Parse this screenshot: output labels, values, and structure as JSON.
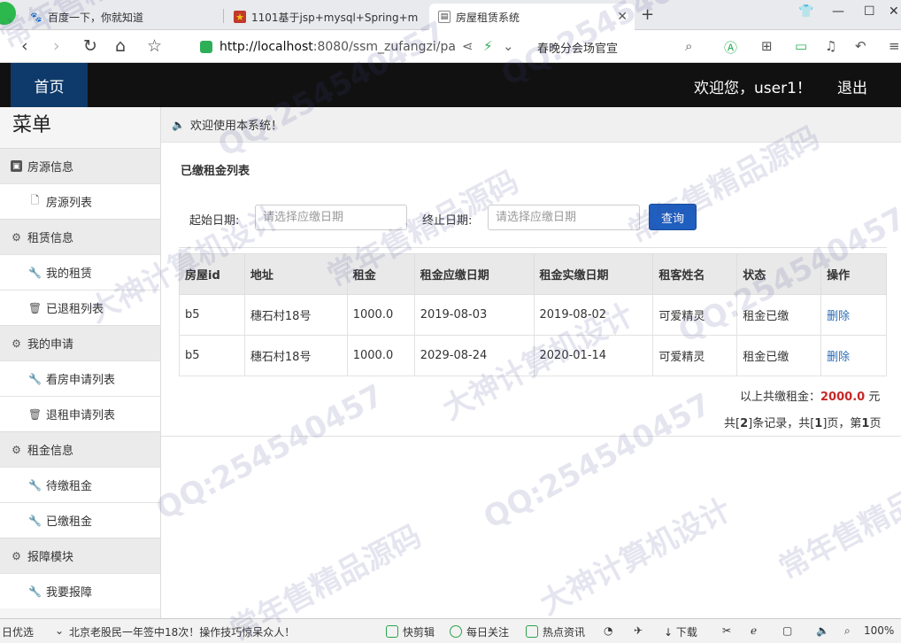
{
  "browser": {
    "tabs": [
      {
        "label": "百度一下，你就知道",
        "icon": "paw-icon"
      },
      {
        "label": "1101基于jsp+mysql+Spring+m",
        "icon": "site-icon"
      },
      {
        "label": "房屋租赁系统",
        "icon": "page-icon",
        "active": true
      }
    ],
    "url_host": "http://localhost",
    "url_rest": ":8080/ssm_zufangzi/pa",
    "bookmark": "春晚分会场官宣",
    "zoom": "100%"
  },
  "header": {
    "home": "首页",
    "welcome": "欢迎您，user1！",
    "logout": "退出"
  },
  "sidebar": {
    "title": "菜单",
    "groups": [
      {
        "label": "房源信息",
        "items": [
          "房源列表"
        ]
      },
      {
        "label": "租赁信息",
        "items": [
          "我的租赁",
          "已退租列表"
        ]
      },
      {
        "label": "我的申请",
        "items": [
          "看房申请列表",
          "退租申请列表"
        ]
      },
      {
        "label": "租金信息",
        "items": [
          "待缴租金",
          "已缴租金"
        ]
      },
      {
        "label": "报障模块",
        "items": [
          "我要报障"
        ]
      }
    ]
  },
  "main": {
    "notice": "欢迎使用本系统！",
    "section_title": "已缴租金列表",
    "filter": {
      "start_label": "起始日期:",
      "start_placeholder": "请选择应缴日期",
      "end_label": "终止日期:",
      "end_placeholder": "请选择应缴日期",
      "query": "查询"
    },
    "table": {
      "headers": [
        "房屋id",
        "地址",
        "租金",
        "租金应缴日期",
        "租金实缴日期",
        "租客姓名",
        "状态",
        "操作"
      ],
      "rows": [
        [
          "b5",
          "穗石村18号",
          "1000.0",
          "2019-08-03",
          "2019-08-02",
          "可爱精灵",
          "租金已缴",
          "删除"
        ],
        [
          "b5",
          "穗石村18号",
          "1000.0",
          "2029-08-24",
          "2020-01-14",
          "可爱精灵",
          "租金已缴",
          "删除"
        ]
      ]
    },
    "total": {
      "label": "以上共缴租金：",
      "amount": "2000.0",
      "unit": "元"
    },
    "pager": {
      "p1": "共[",
      "records": "2",
      "p2": "]条记录，共[",
      "pages": "1",
      "p3": "]页，第",
      "current": "1",
      "p4": "页"
    }
  },
  "statusbar": {
    "left": "日优选",
    "news": "北京老股民一年签中18次！操作技巧惊呆众人！",
    "items": [
      "快剪辑",
      "每日关注",
      "热点资讯",
      "下载"
    ],
    "zoom": "100%"
  },
  "watermarks": [
    "QQ:254540457",
    "常年售精品源码",
    "大神计算机设计"
  ]
}
